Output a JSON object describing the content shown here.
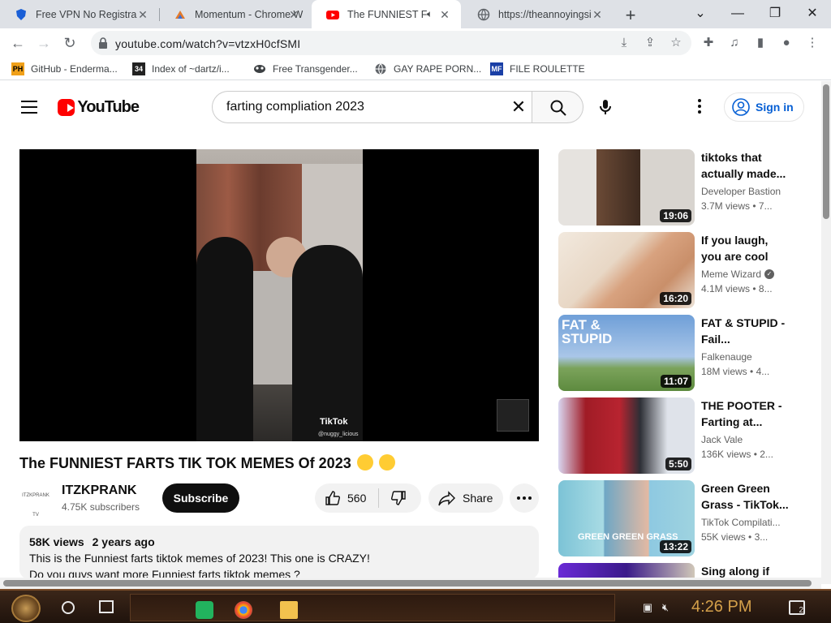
{
  "browser": {
    "tabs": [
      {
        "title": "Free VPN No Registra",
        "active": false
      },
      {
        "title": "Momentum - Chrome W",
        "active": false
      },
      {
        "title": "The FUNNIEST F",
        "active": true
      },
      {
        "title": "https://theannoyingsi",
        "active": false
      }
    ],
    "url": "youtube.com/watch?v=vtzxH0cfSMI",
    "bookmarks": [
      {
        "label": "GitHub - Enderma...",
        "icon": "PH"
      },
      {
        "label": "Index of ~dartz/i...",
        "icon": "34"
      },
      {
        "label": "Free Transgender...",
        "icon": "mask"
      },
      {
        "label": "GAY RAPE PORN...",
        "icon": "globe"
      },
      {
        "label": "FILE ROULETTE",
        "icon": "MF"
      }
    ]
  },
  "youtube": {
    "logo_text": "YouTube",
    "search_value": "farting compliation 2023",
    "signin_label": "Sign in",
    "video": {
      "title": "The FUNNIEST FARTS TIK TOK MEMES Of 2023",
      "tiktok_label": "TikTok",
      "tiktok_user": "@nuggy_licious",
      "channel_avatar_text": "ITZKPRANK TV",
      "channel_name": "ITZKPRANK",
      "subscribers": "4.75K subscribers",
      "subscribe_label": "Subscribe",
      "likes": "560",
      "share_label": "Share",
      "views": "58K views",
      "age": "2 years ago",
      "description_lines": [
        "This is the Funniest farts tiktok memes of 2023! This one is CRAZY!",
        "Do you guys want more Funniest farts tiktok memes ?"
      ]
    },
    "recommendations": [
      {
        "title1": "tiktoks that",
        "title2": "actually made...",
        "channel": "Developer Bastion",
        "views": "3.7M views",
        "age": "7...",
        "duration": "19:06",
        "verified": false
      },
      {
        "title1": "If you laugh,",
        "title2": "you are cool",
        "channel": "Meme Wizard",
        "views": "4.1M views",
        "age": "8...",
        "duration": "16:20",
        "verified": true
      },
      {
        "title1": "FAT & STUPID -",
        "title2": "Fail...",
        "channel": "Falkenauge",
        "views": "18M views",
        "age": "4...",
        "duration": "11:07",
        "verified": false,
        "thumb_text": "FAT & STUPID"
      },
      {
        "title1": "THE POOTER -",
        "title2": "Farting at...",
        "channel": "Jack Vale",
        "views": "136K views",
        "age": "2...",
        "duration": "5:50",
        "verified": false
      },
      {
        "title1": "Green Green",
        "title2": "Grass - TikTok...",
        "channel": "TikTok Compilati...",
        "views": "55K views",
        "age": "3...",
        "duration": "13:22",
        "verified": false,
        "thumb_text": "GREEN GREEN GRASS"
      },
      {
        "title1": "Sing along if",
        "title2": "",
        "channel": "",
        "views": "",
        "age": "",
        "duration": "",
        "verified": false
      }
    ]
  },
  "taskbar": {
    "clock": "4:26 PM",
    "notification_count": "2"
  }
}
